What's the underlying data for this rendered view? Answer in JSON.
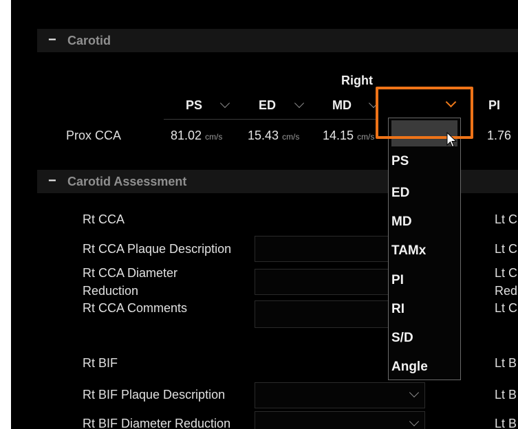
{
  "carotid_section": {
    "toggle": "−",
    "title": "Carotid"
  },
  "table": {
    "side_label": "Right",
    "columns": [
      "PS",
      "ED",
      "MD",
      "",
      "PI"
    ],
    "row": {
      "label": "Prox CCA",
      "ps_value": "81.02",
      "ps_unit": "cm/s",
      "ed_value": "15.43",
      "ed_unit": "cm/s",
      "md_value": "14.15",
      "md_unit": "cm/s",
      "pi_value": "1.76"
    }
  },
  "dropdown": {
    "selected": "",
    "options": [
      "PS",
      "ED",
      "MD",
      "TAMx",
      "PI",
      "RI",
      "S/D",
      "Angle"
    ]
  },
  "assessment_section": {
    "toggle": "−",
    "title": "Carotid Assessment"
  },
  "right_labels": {
    "rt_cca": "Rt CCA",
    "rt_cca_plaque": "Rt CCA Plaque Description",
    "rt_cca_diam_1": "Rt CCA Diameter",
    "rt_cca_diam_2": "Reduction",
    "rt_cca_comments": "Rt CCA Comments",
    "rt_bif": "Rt BIF",
    "rt_bif_plaque": "Rt BIF Plaque Description",
    "rt_bif_diam": "Rt BIF Diameter Reduction"
  },
  "left_labels": {
    "lt_cca": "Lt C",
    "lt_cca_plaque": "Lt C",
    "lt_cca_diam_1": "Lt C",
    "lt_cca_diam_2": "Red",
    "lt_cca_comments": "Lt C",
    "lt_bif": "Lt B",
    "lt_bif_plaque": "Lt B",
    "lt_bif_diam": "Lt B"
  },
  "colors": {
    "highlight": "#ee7318",
    "background": "#000000"
  }
}
